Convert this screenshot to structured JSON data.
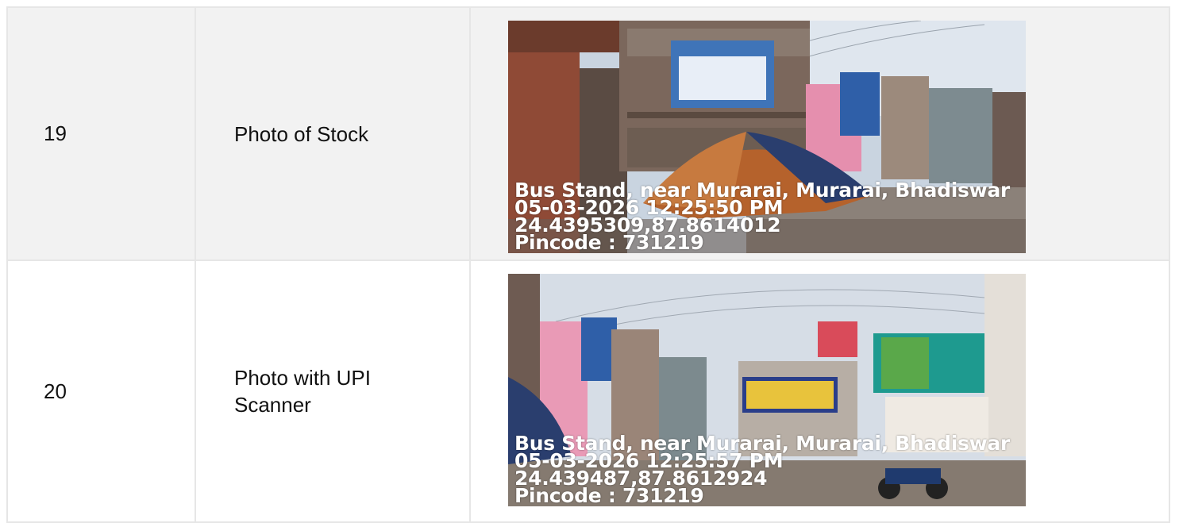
{
  "rows": [
    {
      "number": "19",
      "label": "Photo of Stock",
      "photo": {
        "address": "Bus Stand, near Murarai, Murarai, Bhadiswar",
        "datetime": "05-03-2026 12:25:50 PM",
        "coords": "24.4395309,87.8614012",
        "pincode": "Pincode : 731219"
      }
    },
    {
      "number": "20",
      "label_line1": "Photo with UPI",
      "label_line2": "Scanner",
      "photo": {
        "address": "Bus Stand, near Murarai, Murarai, Bhadiswar",
        "datetime": "05-03-2026 12:25:57 PM",
        "coords": "24.439487,87.8612924",
        "pincode": "Pincode : 731219"
      }
    }
  ],
  "colors": {
    "border": "#e6e6e6",
    "row_alt_bg": "#f2f2f2",
    "text": "#111111",
    "overlay_text": "#ffffff"
  }
}
